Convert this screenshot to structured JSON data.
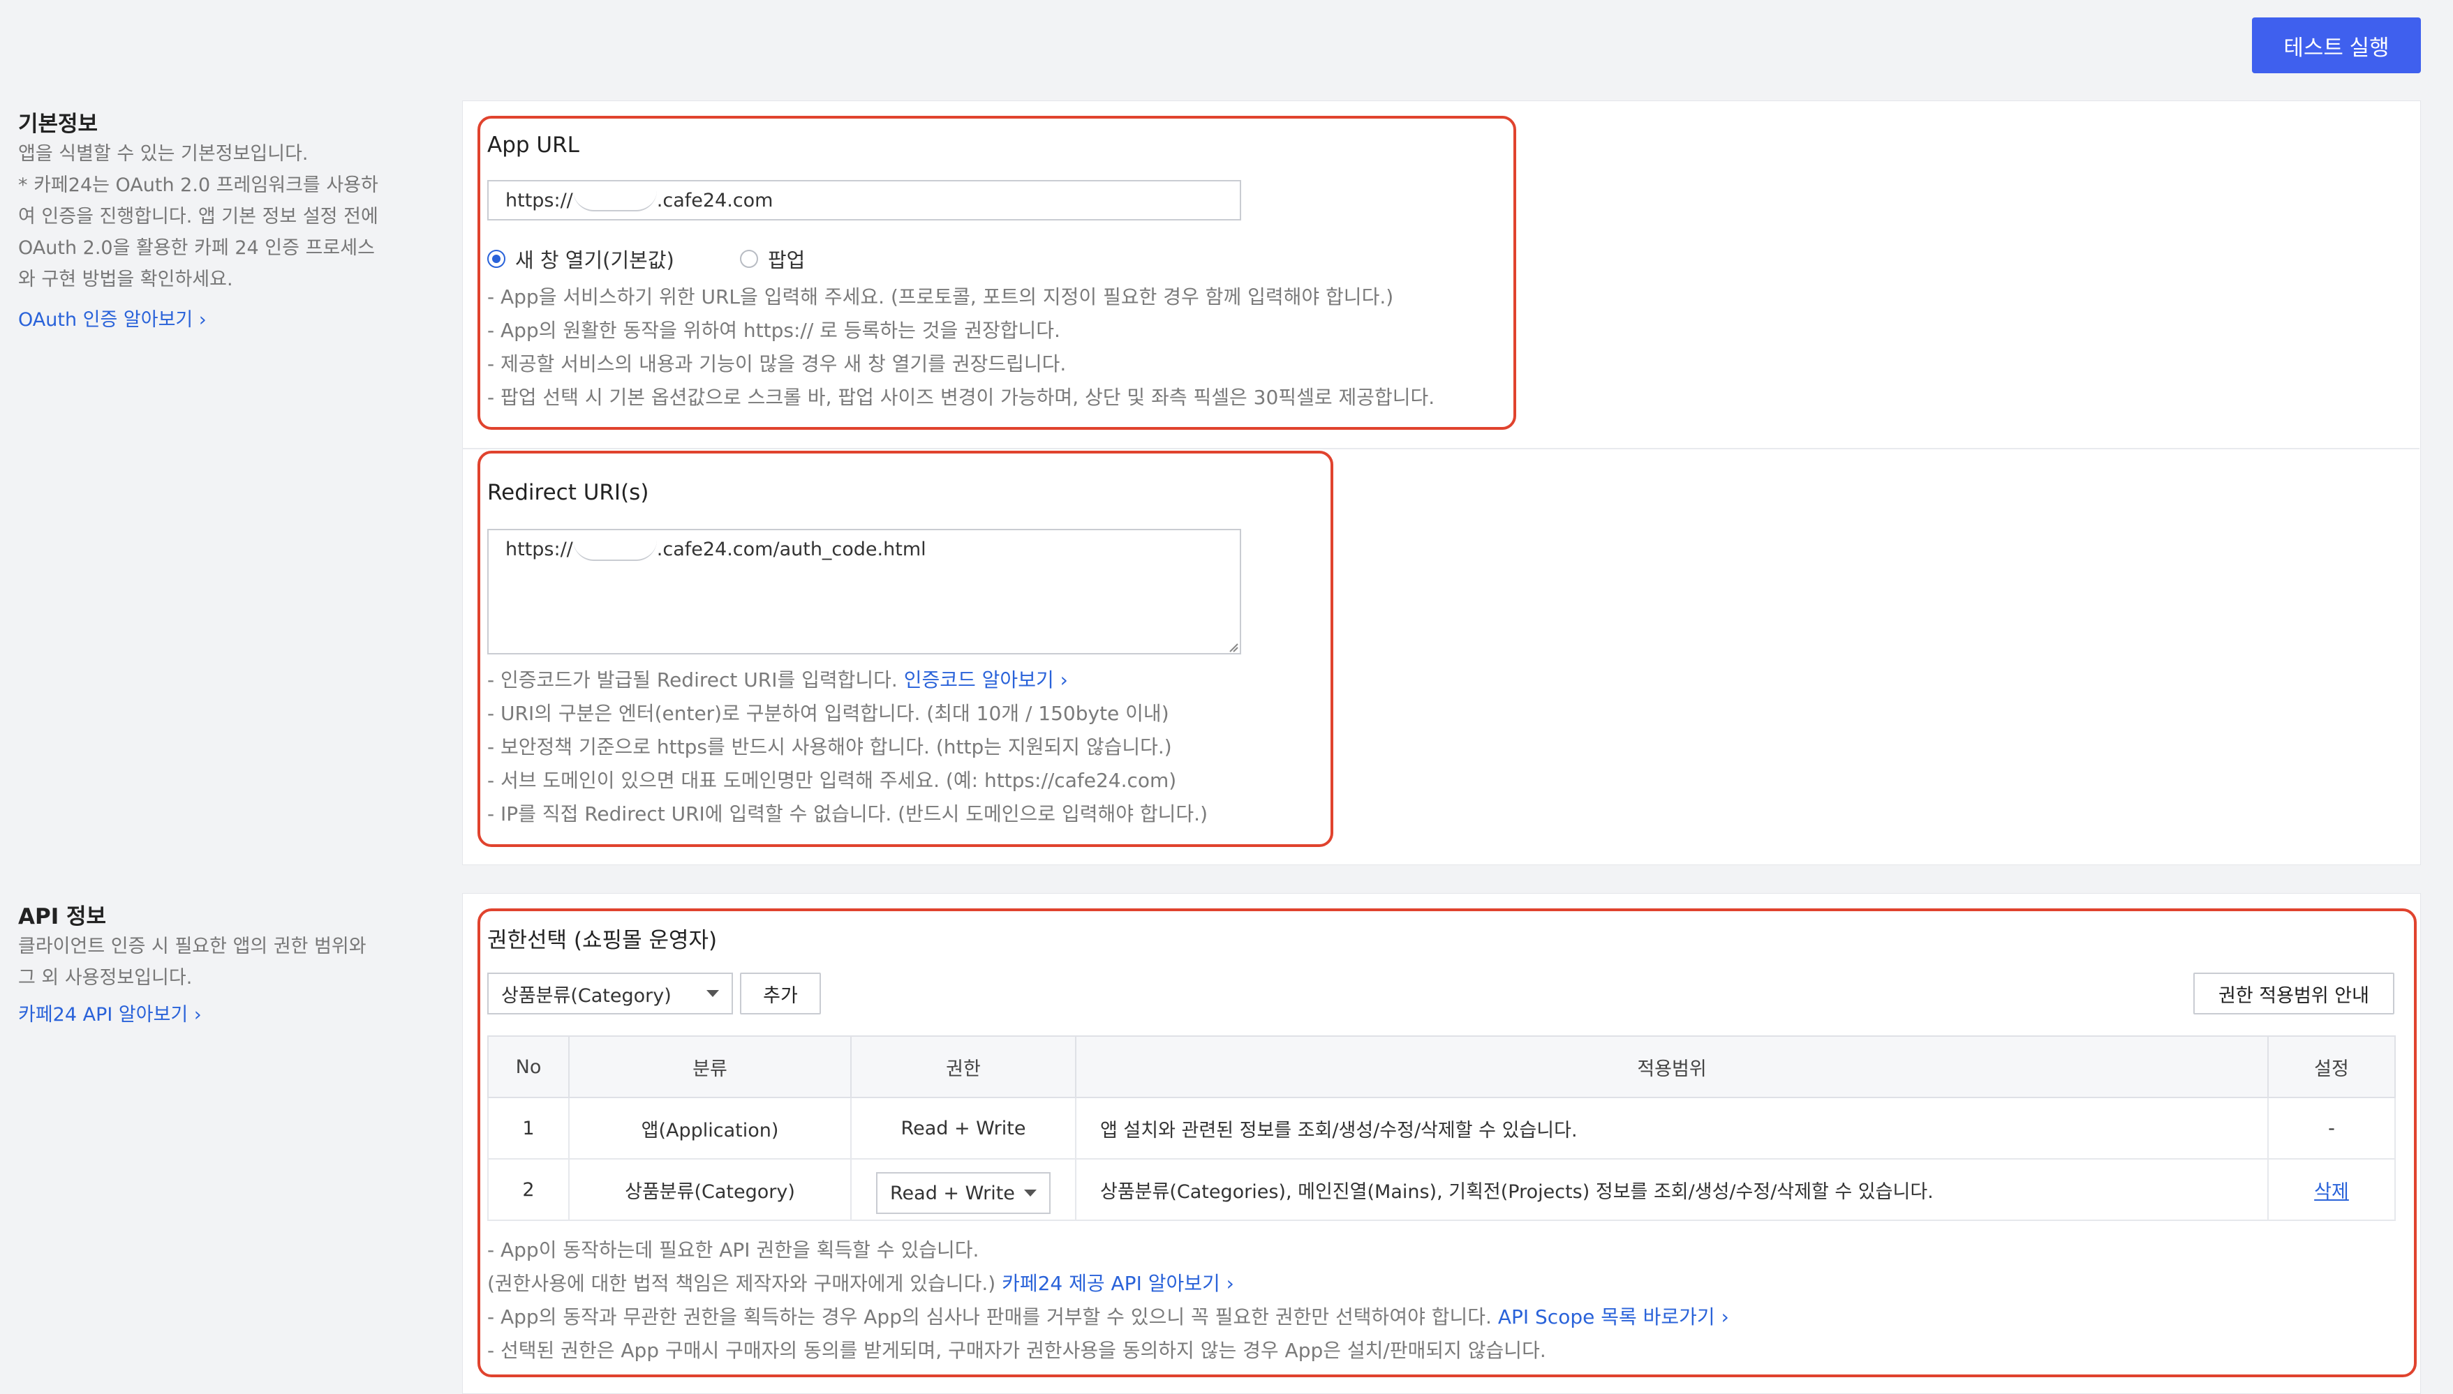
{
  "header": {
    "test_button": "테스트 실행"
  },
  "basic_info": {
    "title": "기본정보",
    "desc_lines": [
      "앱을 식별할 수 있는 기본정보입니다.",
      "* 카페24는 OAuth 2.0 프레임워크를 사용하",
      "여 인증을 진행합니다. 앱 기본 정보 설정 전에",
      "OAuth 2.0을 활용한 카페 24 인증 프로세스",
      "와 구현 방법을 확인하세요."
    ],
    "link": "OAuth 인증 알아보기 ›"
  },
  "app_url": {
    "label": "App URL",
    "value_prefix": "https://",
    "value_suffix": ".cafe24.com",
    "radio_new_window": "새 창 열기(기본값)",
    "radio_popup": "팝업",
    "help": [
      "- App을 서비스하기 위한 URL을 입력해 주세요. (프로토콜, 포트의 지정이 필요한 경우 함께 입력해야 합니다.)",
      "- App의 원활한 동작을 위하여 https:// 로 등록하는 것을 권장합니다.",
      "- 제공할 서비스의 내용과 기능이 많을 경우 새 창 열기를 권장드립니다.",
      "- 팝업 선택 시 기본 옵션값으로 스크롤 바, 팝업 사이즈 변경이 가능하며, 상단 및 좌측 픽셀은 30픽셀로 제공합니다."
    ]
  },
  "redirect": {
    "label": "Redirect URI(s)",
    "value_prefix": "https://",
    "value_suffix": ".cafe24.com/auth_code.html",
    "help1_text": "- 인증코드가 발급될 Redirect URI를 입력합니다. ",
    "help1_link": "인증코드 알아보기 ›",
    "help": [
      "- URI의 구분은 엔터(enter)로 구분하여 입력합니다. (최대 10개 / 150byte 이내)",
      "- 보안정책 기준으로 https를 반드시 사용해야 합니다. (http는 지원되지 않습니다.)",
      "- 서브 도메인이 있으면 대표 도메인명만 입력해 주세요. (예: https://cafe24.com)",
      "- IP를 직접 Redirect URI에 입력할 수 없습니다. (반드시 도메인으로 입력해야 합니다.)"
    ]
  },
  "api_info": {
    "title": "API 정보",
    "desc_lines": [
      "클라이언트 인증 시 필요한 앱의 권한 범위와",
      "그 외 사용정보입니다."
    ],
    "link": "카페24 API 알아보기 ›"
  },
  "permission": {
    "label": "권한선택 (쇼핑몰 운영자)",
    "select_value": "상품분류(Category)",
    "add_button": "추가",
    "scope_guide_button": "권한 적용범위 안내",
    "columns": [
      "No",
      "분류",
      "권한",
      "적용범위",
      "설정"
    ],
    "rows": [
      {
        "no": "1",
        "category": "앱(Application)",
        "permission": "Read + Write",
        "scope": "앱 설치와 관련된 정보를 조회/생성/수정/삭제할 수 있습니다.",
        "setting": "-"
      },
      {
        "no": "2",
        "category": "상품분류(Category)",
        "permission": "Read + Write",
        "scope": "상품분류(Categories), 메인진열(Mains), 기획전(Projects) 정보를 조회/생성/수정/삭제할 수 있습니다.",
        "setting": "삭제"
      }
    ],
    "help1": "- App이 동작하는데 필요한 API 권한을 획득할 수 있습니다.",
    "help2_text": "  (권한사용에 대한 법적 책임은 제작자와 구매자에게 있습니다.) ",
    "help2_link": "카페24 제공 API 알아보기 ›",
    "help3_text": "- App의 동작과 무관한 권한을 획득하는 경우 App의 심사나 판매를 거부할 수 있으니 꼭 필요한 권한만 선택하여야 합니다. ",
    "help3_link": "API Scope 목록 바로가기 ›",
    "help4": "- 선택된 권한은 App 구매시 구매자의 동의를 받게되며, 구매자가 권한사용을 동의하지 않는 경우 App은 설치/판매되지 않습니다."
  },
  "colors": {
    "accent": "#3f60ee",
    "link": "#2962d9",
    "highlight_border": "#e0432e"
  }
}
